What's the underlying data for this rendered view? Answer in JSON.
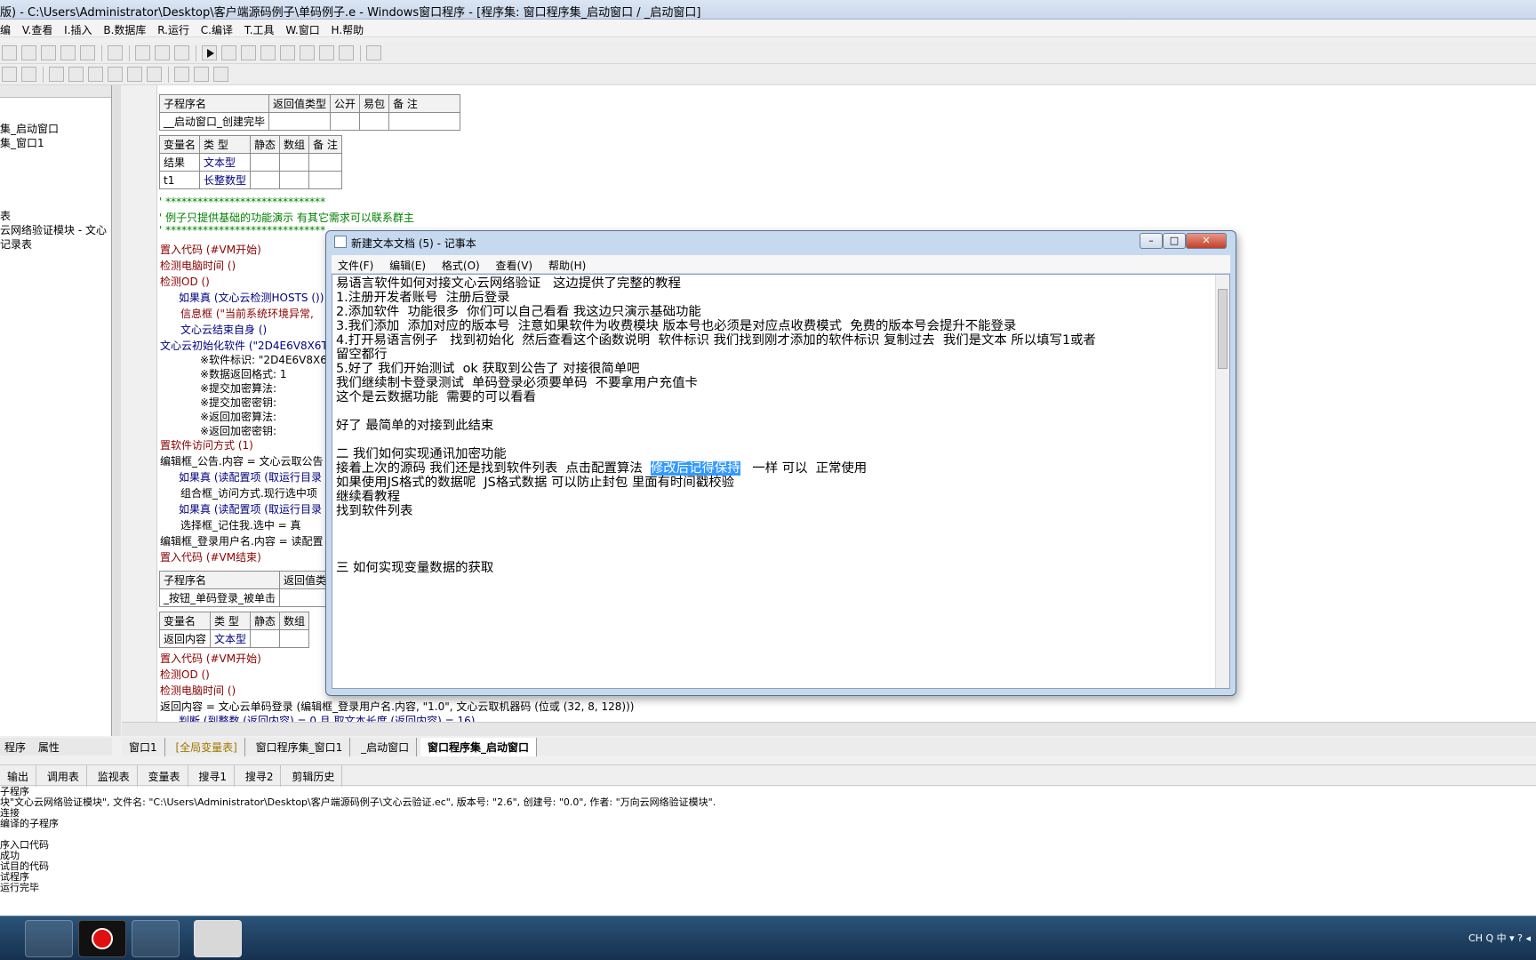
{
  "window": {
    "title": "版) - C:\\Users\\Administrator\\Desktop\\客户端源码例子\\单码例子.e - Windows窗口程序 - [程序集: 窗口程序集_启动窗口 / _启动窗口]"
  },
  "menu": [
    "编",
    "V.查看",
    "I.插入",
    "B.数据库",
    "R.运行",
    "C.编译",
    "T.工具",
    "W.窗口",
    "H.帮助"
  ],
  "left_panel": {
    "items": [
      "集_启动窗口",
      "集_窗口1",
      "表",
      "云网络验证模块 - 文心",
      "记录表"
    ]
  },
  "tables": {
    "sub1": {
      "headers": [
        "子程序名",
        "返回值类型",
        "公开",
        "易包",
        "备 注"
      ],
      "row": [
        "__启动窗口_创建完毕",
        "",
        "",
        "",
        ""
      ]
    },
    "var1": {
      "headers": [
        "变量名",
        "类 型",
        "静态",
        "数组",
        "备 注"
      ],
      "rows": [
        [
          "结果",
          "文本型",
          "",
          "",
          ""
        ],
        [
          "t1",
          "长整数型",
          "",
          "",
          ""
        ]
      ]
    },
    "sub2": {
      "headers": [
        "子程序名",
        "返回值类"
      ],
      "row": [
        "_按钮_单码登录_被单击",
        ""
      ]
    },
    "var2": {
      "headers": [
        "变量名",
        "类 型",
        "静态",
        "数组"
      ],
      "rows": [
        [
          "返回内容",
          "文本型",
          "",
          ""
        ]
      ]
    }
  },
  "code": {
    "stars1": "' ******************************",
    "comment": "' 例子只提供基础的功能演示  有其它需求可以联系群主",
    "stars2": "' ******************************",
    "l1": "置入代码 (#VM开始)",
    "l2": "检测电脑时间 ()",
    "l3": "检测OD ()",
    "l4": "如果真 (文心云检测HOSTS ())",
    "l5": "信息框 (\"当前系统环境异常,",
    "l6": "文心云结束自身 ()",
    "l7": "文心云初始化软件 (\"2D4E6V8X6T5",
    "l8": "※软件标识:  \"2D4E6V8X6",
    "l9": "※数据返回格式:  1",
    "l10": "※提交加密算法:",
    "l11": "※提交加密密钥:",
    "l12": "※返回加密算法:",
    "l13": "※返回加密密钥:",
    "l14": "置软件访问方式 (1)",
    "l15": "编辑框_公告.内容 = 文心云取公告",
    "l16": "如果真 (读配置项 (取运行目录",
    "l17": "组合框_访问方式.现行选中项",
    "l18": "如果真 (读配置项 (取运行目录",
    "l19": "选择框_记住我.选中 = 真",
    "l20": "编辑框_登录用户名.内容 = 读配置",
    "l21": "置入代码 (#VM结束)",
    "m1": "置入代码 (#VM开始)",
    "m2": "检测OD ()",
    "m3": "检测电脑时间 ()",
    "m4": "返回内容 = 文心云单码登录 (编辑框_登录用户名.内容, \"1.0\", 文心云取机器码 (位或 (32, 8, 128)))",
    "m5": "判断 (到整数 (返回内容) = 0 且 取文本长度 (返回内容) = 16)"
  },
  "left_tabs": [
    "程序",
    "属性"
  ],
  "editor_tabs": [
    "窗口1",
    "[全局变量表]",
    "窗口程序集_窗口1",
    "_启动窗口",
    "窗口程序集_启动窗口"
  ],
  "output_tabs": [
    "输出",
    "调用表",
    "监视表",
    "变量表",
    "搜寻1",
    "搜寻2",
    "剪辑历史"
  ],
  "output_lines": [
    "子程序",
    "块\"文心云网络验证模块\", 文件名: \"C:\\Users\\Administrator\\Desktop\\客户端源码例子\\文心云验证.ec\", 版本号: \"2.6\", 创建号: \"0.0\", 作者: \"万向云网络验证模块\".",
    "连接",
    "编译的子程序",
    "",
    "序入口代码",
    "成功",
    "试目的代码",
    "试程序",
    "运行完毕"
  ],
  "notepad": {
    "title": "新建文本文档 (5) - 记事本",
    "menu": [
      "文件(F)",
      "编辑(E)",
      "格式(O)",
      "查看(V)",
      "帮助(H)"
    ],
    "text_before": "易语言软件如何对接文心云网络验证   这边提供了完整的教程\n1.注册开发者账号  注册后登录\n2.添加软件  功能很多  你们可以自己看看 我这边只演示基础功能\n3.我们添加  添加对应的版本号  注意如果软件为收费模块 版本号也必须是对应点收费模式  免费的版本号会提升不能登录\n4.打开易语言例子   找到初始化  然后查看这个函数说明  软件标识 我们找到刚才添加的软件标识 复制过去  我们是文本 所以填写1或者\n留空都行\n5.好了 我们开始测试  ok 获取到公告了 对接很简单吧\n我们继续制卡登录测试  单码登录必须要单码  不要拿用户充值卡\n这个是云数据功能  需要的可以看看\n\n好了 最简单的对接到此结束\n\n二 我们如何实现通讯加密功能\n接着上次的源码 我们还是找到软件列表  点击配置算法  ",
    "selected": "修改后记得保持",
    "text_after": "   一样 可以  正常使用\n如果使用JS格式的数据呢  JS格式数据 可以防止封包 里面有时间戳校验\n继续看教程\n找到软件列表\n\n\n\n三 如何实现变量数据的获取"
  },
  "tray": {
    "text": "CH  Q  中 ▾  ?  ◂"
  }
}
